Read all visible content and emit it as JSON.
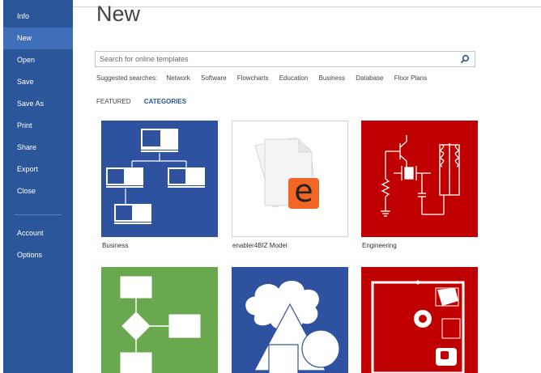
{
  "sidebar": {
    "items": [
      {
        "label": "Info"
      },
      {
        "label": "New"
      },
      {
        "label": "Open"
      },
      {
        "label": "Save"
      },
      {
        "label": "Save As"
      },
      {
        "label": "Print"
      },
      {
        "label": "Share"
      },
      {
        "label": "Export"
      },
      {
        "label": "Close"
      },
      {
        "label": "Account"
      },
      {
        "label": "Options"
      }
    ],
    "active": "New"
  },
  "page": {
    "title": "New"
  },
  "search": {
    "placeholder": "Search for online templates",
    "value": "",
    "icon": "search-icon"
  },
  "suggested": {
    "label": "Suggested searches:",
    "links": [
      "Network",
      "Software",
      "Flowcharts",
      "Education",
      "Business",
      "Database",
      "Floor Plans"
    ]
  },
  "tabs": [
    {
      "label": "FEATURED",
      "active": false
    },
    {
      "label": "CATEGORIES",
      "active": true
    }
  ],
  "templates": [
    {
      "label": "Business",
      "color": "#2f52a0"
    },
    {
      "label": "enabler4BIZ Model",
      "color": "#ffffff",
      "logo_letter": "e",
      "logo_color": "#f26522"
    },
    {
      "label": "Engineering",
      "color": "#c00000"
    },
    {
      "label": "",
      "color": "#6aa84f"
    },
    {
      "label": "",
      "color": "#2f52a0"
    },
    {
      "label": "",
      "color": "#c00000"
    }
  ],
  "colors": {
    "sidebar": "#2b579a",
    "sidebar_active": "#3f6fb8",
    "accent": "#2b579a"
  }
}
